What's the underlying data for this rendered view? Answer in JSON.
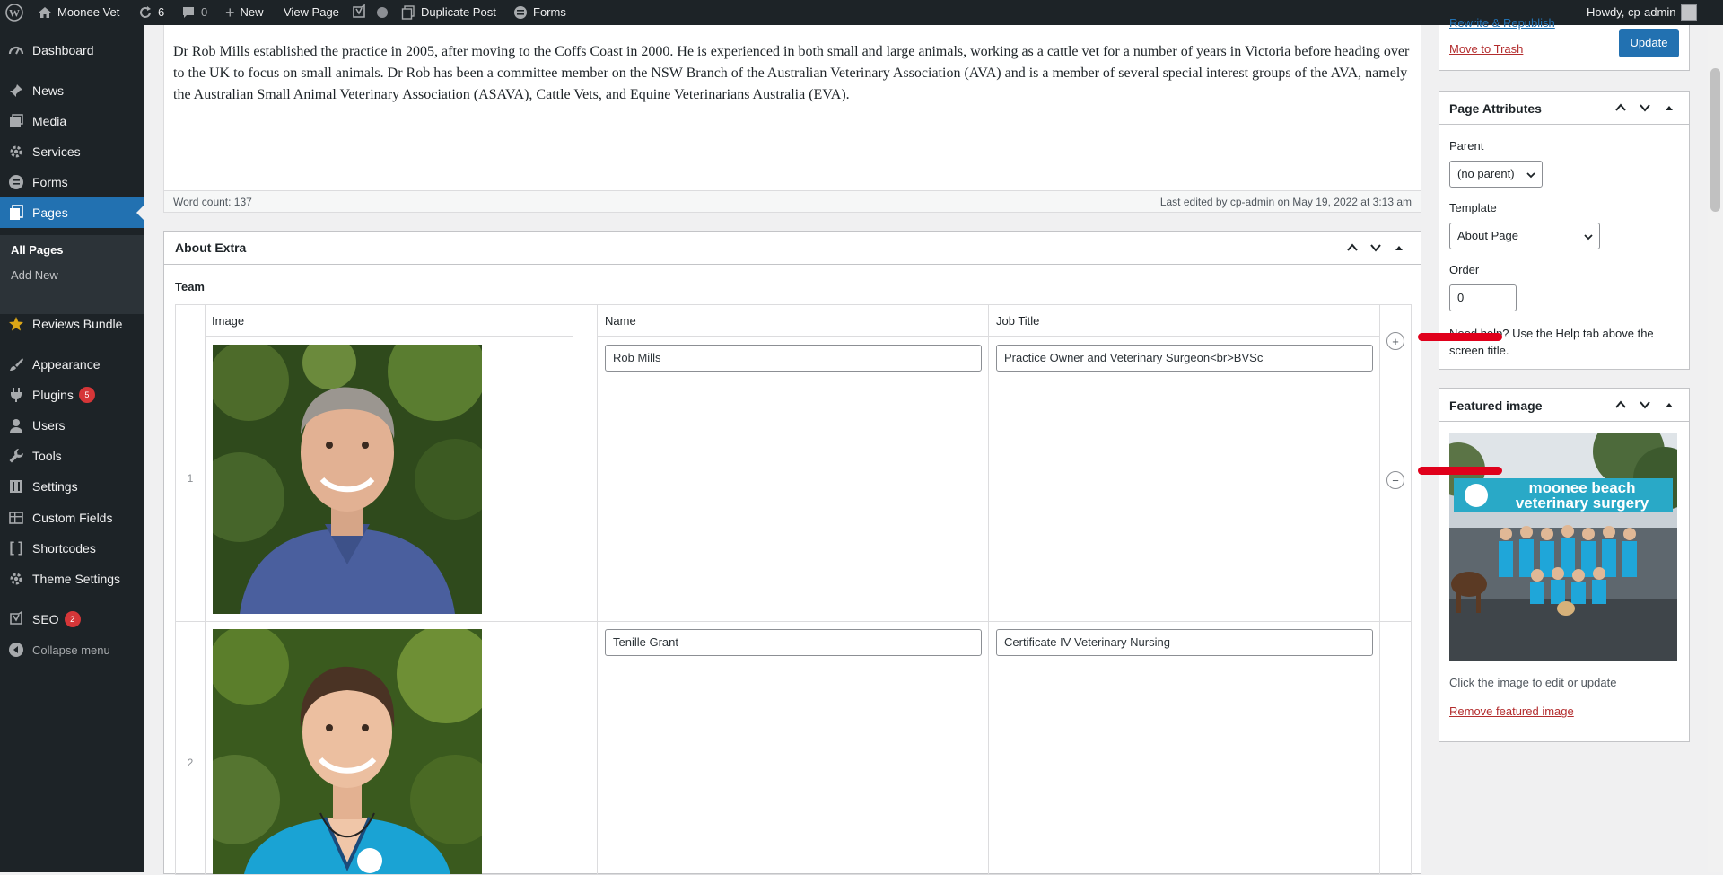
{
  "adminbar": {
    "site_name": "Moonee Vet",
    "updates_count": "6",
    "comments_count": "0",
    "new_label": "New",
    "view_page": "View Page",
    "duplicate_post": "Duplicate Post",
    "forms": "Forms",
    "howdy": "Howdy, cp-admin"
  },
  "sidebar": {
    "items": [
      {
        "label": "Dashboard",
        "icon": "dashboard-icon"
      },
      {
        "label": "News",
        "icon": "pin-icon"
      },
      {
        "label": "Media",
        "icon": "media-icon"
      },
      {
        "label": "Services",
        "icon": "gear-icon"
      },
      {
        "label": "Forms",
        "icon": "forms-icon"
      },
      {
        "label": "Pages",
        "icon": "page-icon"
      },
      {
        "label": "Reviews Bundle",
        "icon": "star-icon"
      },
      {
        "label": "Appearance",
        "icon": "brush-icon"
      },
      {
        "label": "Plugins",
        "icon": "plugin-icon",
        "badge": "5"
      },
      {
        "label": "Users",
        "icon": "user-icon"
      },
      {
        "label": "Tools",
        "icon": "wrench-icon"
      },
      {
        "label": "Settings",
        "icon": "settings-icon"
      },
      {
        "label": "Custom Fields",
        "icon": "table-icon"
      },
      {
        "label": "Shortcodes",
        "icon": "bracket-icon"
      },
      {
        "label": "Theme Settings",
        "icon": "gear-icon"
      },
      {
        "label": "SEO",
        "icon": "yoast-icon",
        "badge": "2"
      },
      {
        "label": "Collapse menu",
        "icon": "collapse-icon"
      }
    ],
    "submenu": [
      "All Pages",
      "Add New"
    ]
  },
  "content": {
    "text": "Dr Rob Mills established the practice in 2005, after moving to the Coffs Coast in 2000. He is experienced in both small and large animals, working as a cattle vet for a number of years in Victoria before heading over to the UK to focus on small animals. Dr Rob has been a committee member on the NSW Branch of the Australian Veterinary Association (AVA) and is a member of several special interest groups of the AVA, namely the Australian Small Animal Veterinary Association (ASAVA), Cattle Vets, and Equine Veterinarians Australia (EVA).",
    "word_count": "Word count: 137",
    "last_edited": "Last edited by cp-admin on May 19, 2022 at 3:13 am"
  },
  "about_extra": {
    "title": "About Extra",
    "team_label": "Team",
    "columns": [
      "Image",
      "Name",
      "Job Title"
    ],
    "rows": [
      {
        "num": "1",
        "name": "Rob Mills",
        "job": "Practice Owner and Veterinary Surgeon<br>BVSc"
      },
      {
        "num": "2",
        "name": "Tenille Grant",
        "job": "Certificate IV Veterinary Nursing"
      }
    ]
  },
  "publish": {
    "partial_link": "Rewrite & Republish",
    "trash": "Move to Trash",
    "update": "Update"
  },
  "page_attributes": {
    "title": "Page Attributes",
    "parent_label": "Parent",
    "parent_value": "(no parent)",
    "template_label": "Template",
    "template_value": "About Page",
    "order_label": "Order",
    "order_value": "0",
    "help": "Need help? Use the Help tab above the screen title."
  },
  "featured_image": {
    "title": "Featured image",
    "sign_line1": "moonee beach",
    "sign_line2": "veterinary surgery",
    "hint": "Click the image to edit or update",
    "remove": "Remove featured image"
  },
  "colors": {
    "admin_dark": "#1d2327",
    "accent": "#2271b1",
    "link_red": "#b32d2e",
    "annotation_red": "#e0001b",
    "badge_red": "#d63638"
  }
}
